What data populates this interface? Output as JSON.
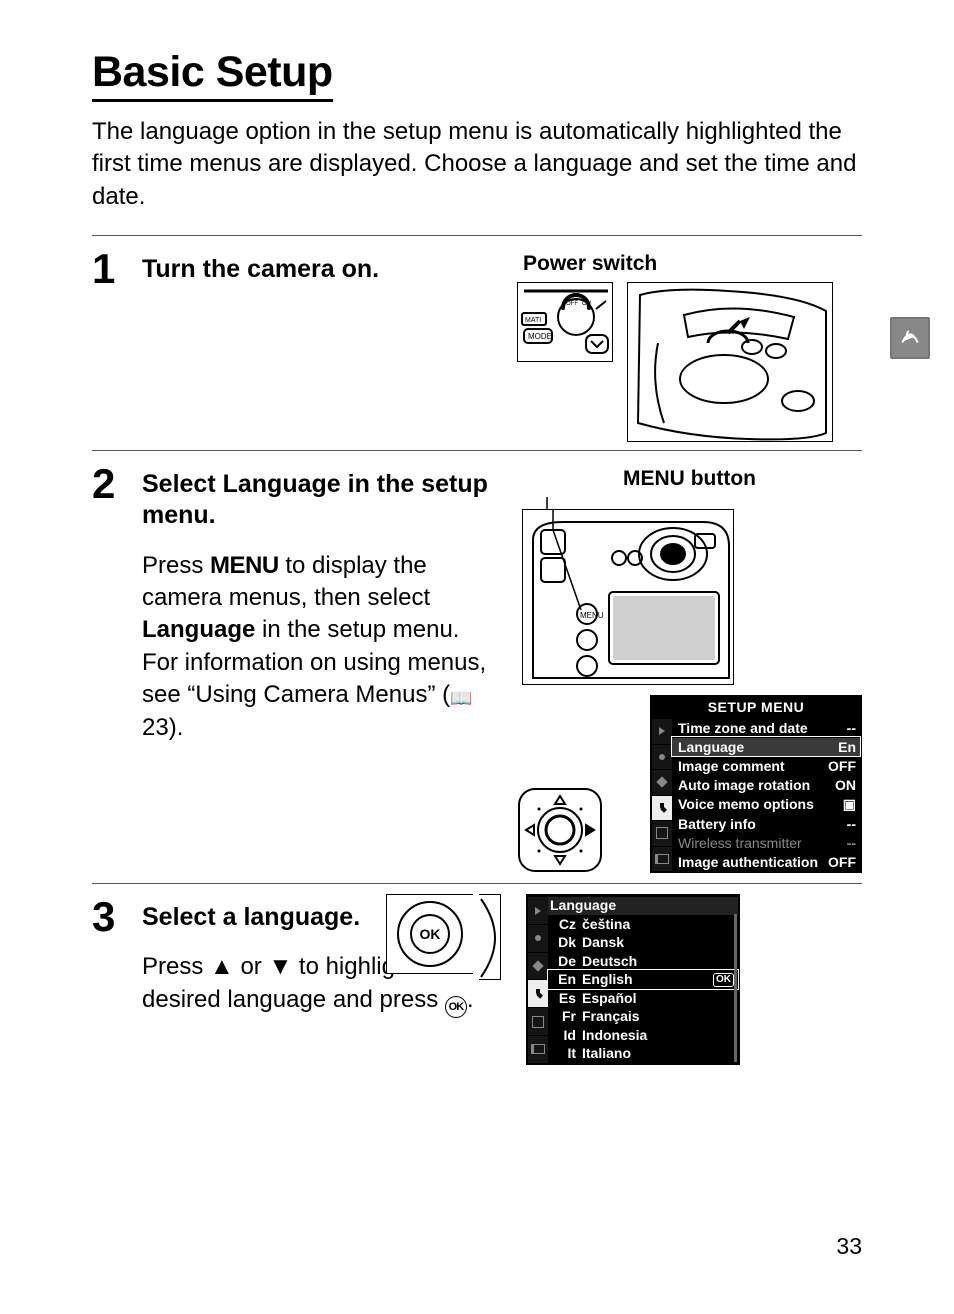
{
  "title": "Basic Setup",
  "intro": "The language option in the setup menu is automatically highlighted the first time menus are displayed. Choose a language and set the time and date.",
  "page_number": "33",
  "steps": {
    "s1": {
      "num": "1",
      "heading": "Turn the camera on.",
      "fig_label": "Power switch"
    },
    "s2": {
      "num": "2",
      "heading_pre": "Select ",
      "heading_bold": "Language",
      "heading_post": " in the setup menu.",
      "fig_label": "MENU button",
      "para_pre": "Press ",
      "para_menu": "MENU",
      "para_mid1": " to display the camera menus, then select ",
      "para_bold": "Language",
      "para_mid2": " in the setup menu. For information on using menus, see “Using Camera Menus” (",
      "para_pgref": " 23).",
      "setup_menu": {
        "title": "SETUP MENU",
        "rows": [
          {
            "label": "Time zone and date",
            "val": "--"
          },
          {
            "label": "Language",
            "val": "En",
            "highlight": true
          },
          {
            "label": "Image comment",
            "val": "OFF"
          },
          {
            "label": "Auto image rotation",
            "val": "ON"
          },
          {
            "label": "Voice memo options",
            "val": "▣"
          },
          {
            "label": "Battery info",
            "val": "--"
          },
          {
            "label": "Wireless transmitter",
            "val": "--",
            "dim": true
          },
          {
            "label": "Image authentication",
            "val": "OFF"
          }
        ]
      }
    },
    "s3": {
      "num": "3",
      "heading": "Select a language.",
      "para_pre": "Press ",
      "para_up": "▲",
      "para_or": " or ",
      "para_down": "▼",
      "para_mid": " to highlight the desired language and press ",
      "para_end": ".",
      "ok_label": "OK",
      "lang_menu": {
        "title": "Language",
        "rows": [
          {
            "code": "Cz",
            "label": "čeština"
          },
          {
            "code": "Dk",
            "label": "Dansk"
          },
          {
            "code": "De",
            "label": "Deutsch"
          },
          {
            "code": "En",
            "label": "English",
            "highlight": true,
            "ok": "OK"
          },
          {
            "code": "Es",
            "label": "Español"
          },
          {
            "code": "Fr",
            "label": "Français"
          },
          {
            "code": "Id",
            "label": "Indonesia"
          },
          {
            "code": "It",
            "label": "Italiano"
          }
        ]
      }
    }
  }
}
